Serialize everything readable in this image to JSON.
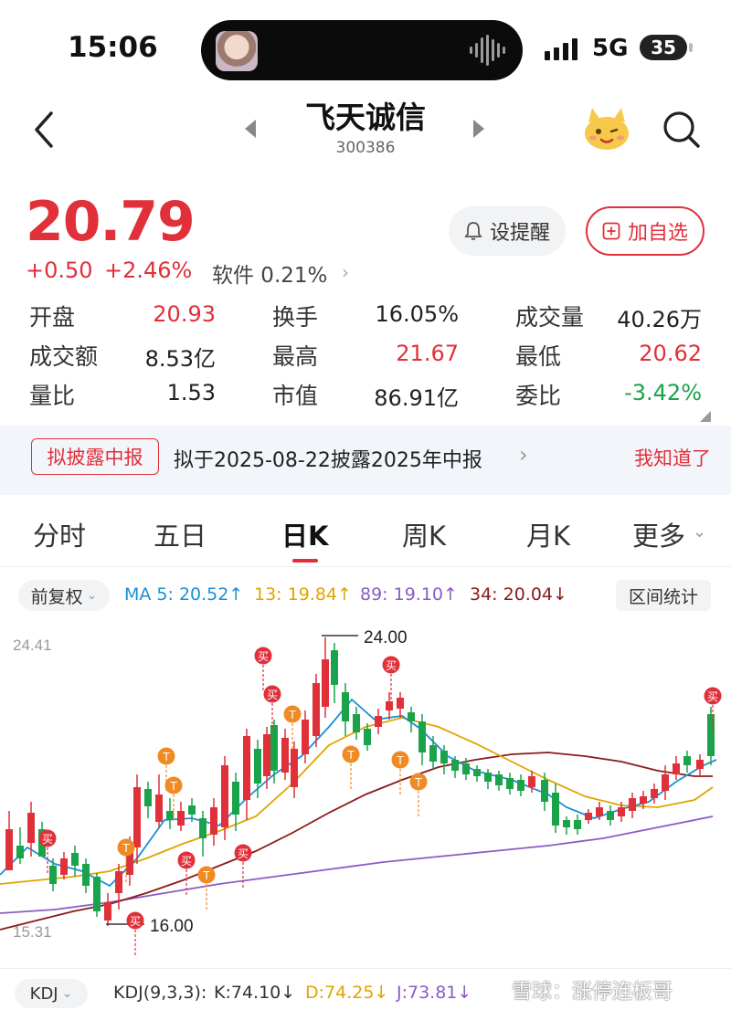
{
  "status_bar": {
    "time": "15:06",
    "network": "5G",
    "battery": "35"
  },
  "header": {
    "title": "飞天诚信",
    "code": "300386"
  },
  "quote": {
    "price": "20.79",
    "change": "+0.50",
    "change_pct": "+2.46%",
    "sector": "软件 0.21%",
    "alert_label": "设提醒",
    "watch_label": "加自选",
    "stats": [
      [
        {
          "label": "开盘",
          "value": "20.93",
          "color": "#e0303a"
        },
        {
          "label": "换手",
          "value": "16.05%",
          "color": "#222222"
        },
        {
          "label": "成交量",
          "value": "40.26万",
          "color": "#222222"
        }
      ],
      [
        {
          "label": "成交额",
          "value": "8.53亿",
          "color": "#222222"
        },
        {
          "label": "最高",
          "value": "21.67",
          "color": "#e0303a"
        },
        {
          "label": "最低",
          "value": "20.62",
          "color": "#e0303a"
        }
      ],
      [
        {
          "label": "量比",
          "value": "1.53",
          "color": "#222222"
        },
        {
          "label": "市值",
          "value": "86.91亿",
          "color": "#222222"
        },
        {
          "label": "委比",
          "value": "-3.42%",
          "color": "#1aa34a"
        }
      ]
    ]
  },
  "notice": {
    "tag": "拟披露中报",
    "text": "拟于2025-08-22披露2025年中报",
    "action": "我知道了"
  },
  "tabs": [
    "分时",
    "五日",
    "日K",
    "周K",
    "月K",
    "更多"
  ],
  "indicators": {
    "adjust": "前复权",
    "ma5": "MA 5: 20.52↑",
    "ma13": "13: 19.84↑",
    "ma89": "89: 19.10↑",
    "ma34": "34: 20.04↓",
    "range": "区间统计"
  },
  "kline": {
    "y_top": "24.41",
    "y_bottom": "15.31",
    "high_label": "24.00",
    "low_label": "16.00",
    "buy_marker": "买",
    "t_marker": "T"
  },
  "kdj": {
    "button": "KDJ",
    "params": "KDJ(9,3,3):",
    "k": "K:74.10↓",
    "d": "D:74.25↓",
    "j": "J:73.81↓"
  },
  "watermark": "雪球：涨停连板哥",
  "colors": {
    "up": "#e0303a",
    "down": "#1aa34a",
    "ma5": "#1a8fd6",
    "ma13": "#e0a400",
    "ma89": "#8a5cc8",
    "ma34": "#8b1a1a"
  }
}
